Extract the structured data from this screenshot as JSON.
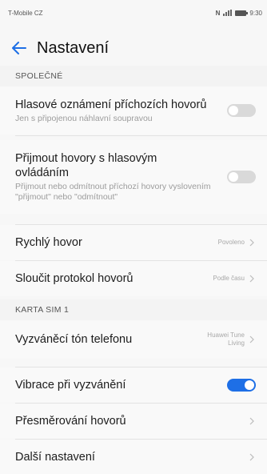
{
  "status_bar": {
    "carrier": "T-Mobile CZ",
    "time": "9:30"
  },
  "app_bar": {
    "title": "Nastavení"
  },
  "sections": {
    "common": {
      "header": "SPOLEČNÉ"
    },
    "sim1": {
      "header": "KARTA SIM 1"
    }
  },
  "items": {
    "voice_announce": {
      "title": "Hlasové oznámení příchozích hovorů",
      "subtitle": "Jen s připojenou náhlavní soupravou",
      "enabled": false
    },
    "voice_control": {
      "title": "Přijmout hovory s hlasovým ovládáním",
      "subtitle": "Přijmout nebo odmítnout příchozí hovory vyslovením \"přijmout\" nebo \"odmítnout\"",
      "enabled": false
    },
    "quick_call": {
      "title": "Rychlý hovor",
      "value": "Povoleno"
    },
    "merge_log": {
      "title": "Sloučit protokol hovorů",
      "value": "Podle času"
    },
    "ringtone": {
      "title": "Vyzváněcí tón telefonu",
      "value_line1": "Huawei Tune",
      "value_line2": "Living"
    },
    "vibrate": {
      "title": "Vibrace při vyzvánění",
      "enabled": true
    },
    "forwarding": {
      "title": "Přesměrování hovorů"
    },
    "more": {
      "title": "Další nastavení"
    }
  },
  "colors": {
    "accent": "#1e6fe6",
    "toggle_off": "#d9d9d9"
  }
}
